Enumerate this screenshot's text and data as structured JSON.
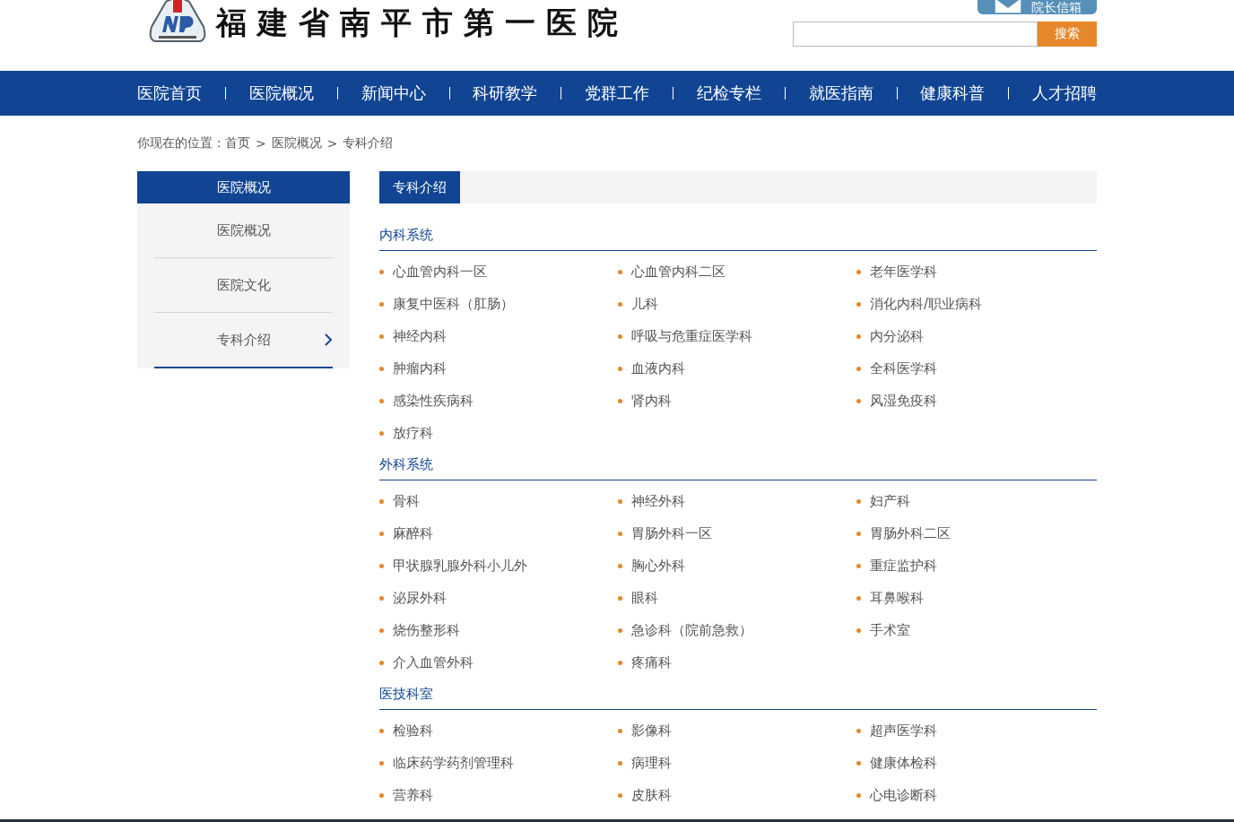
{
  "header": {
    "site_title": "福建省南平市第一医院",
    "mailbox_button": "院长信箱",
    "search": {
      "button": "搜索"
    }
  },
  "nav": [
    {
      "label": "医院首页",
      "selected": false
    },
    {
      "label": "医院概况",
      "selected": false
    },
    {
      "label": "新闻中心",
      "selected": false
    },
    {
      "label": "科研教学",
      "selected": false
    },
    {
      "label": "党群工作",
      "selected": false
    },
    {
      "label": "纪检专栏",
      "selected": false
    },
    {
      "label": "就医指南",
      "selected": false
    },
    {
      "label": "健康科普",
      "selected": false
    },
    {
      "label": "人才招聘",
      "selected": false
    }
  ],
  "breadcrumb": {
    "prefix": "你现在的位置：",
    "items": [
      "首页",
      "医院概况",
      "专科介绍"
    ],
    "separator": ">"
  },
  "sidebar": {
    "title": "医院概况",
    "items": [
      {
        "label": "医院概况",
        "selected": false
      },
      {
        "label": "医院文化",
        "selected": false
      },
      {
        "label": "专科介绍",
        "selected": true
      }
    ]
  },
  "content": {
    "tab": "专科介绍",
    "sections": [
      {
        "title": "内科系统",
        "items": [
          "心血管内科一区",
          "心血管内科二区",
          "老年医学科",
          "康复中医科（肛肠）",
          "儿科",
          " 消化内科/职业病科",
          "神经内科",
          "呼吸与危重症医学科",
          "内分泌科",
          "肿瘤内科",
          "血液内科",
          "全科医学科",
          "感染性疾病科",
          "肾内科",
          "风湿免疫科",
          "放疗科"
        ]
      },
      {
        "title": "外科系统",
        "items": [
          "骨科",
          "神经外科",
          "妇产科",
          "麻醉科",
          "胃肠外科一区",
          "胃肠外科二区",
          "甲状腺乳腺外科小儿外",
          "胸心外科",
          "重症监护科",
          "泌尿外科",
          "眼科",
          "耳鼻喉科",
          "烧伤整形科",
          "急诊科（院前急救）",
          "手术室",
          "介入血管外科",
          "疼痛科"
        ]
      },
      {
        "title": "医技科室",
        "items": [
          "检验科",
          "影像科",
          "超声医学科",
          "临床药学药剂管理科",
          "病理科",
          "健康体检科",
          "营养科",
          "皮肤科",
          "心电诊断科"
        ]
      }
    ]
  }
}
